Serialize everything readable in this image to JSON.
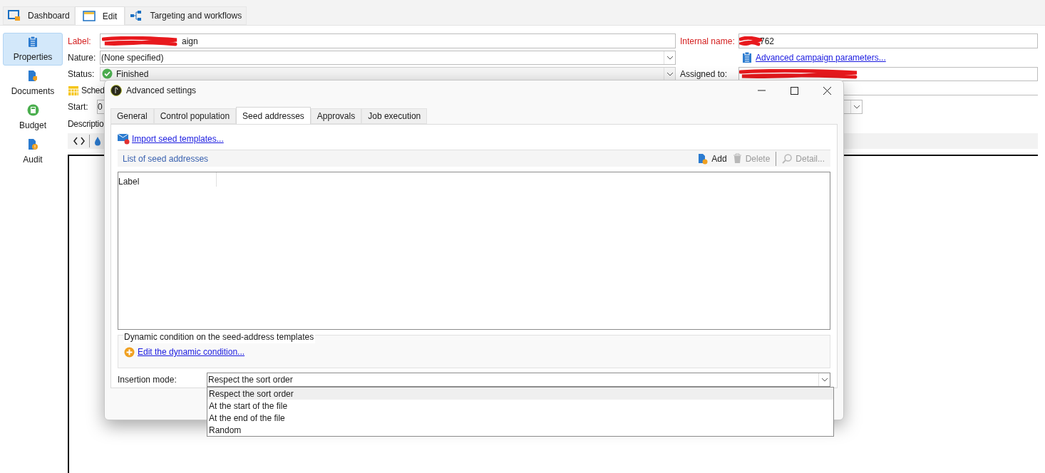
{
  "app_tabs": [
    {
      "label": "Dashboard",
      "selected": false
    },
    {
      "label": "Edit",
      "selected": true
    },
    {
      "label": "Targeting and workflows",
      "selected": false
    }
  ],
  "sidebar": {
    "items": [
      {
        "label": "Properties",
        "selected": true
      },
      {
        "label": "Documents",
        "selected": false
      },
      {
        "label": "Budget",
        "selected": false
      },
      {
        "label": "Audit",
        "selected": false
      }
    ]
  },
  "form": {
    "label": {
      "label": "Label:",
      "value": "aign"
    },
    "internal_name": {
      "label": "Internal name:",
      "value": "762"
    },
    "nature": {
      "label": "Nature:",
      "value": "(None specified)"
    },
    "advanced_link": "Advanced campaign parameters...",
    "status": {
      "label": "Status:",
      "value": "Finished"
    },
    "assigned_to": {
      "label": "Assigned to:"
    },
    "schedule": "Sched",
    "start": {
      "label": "Start:",
      "value": "0"
    },
    "description": "Descriptio"
  },
  "dialog": {
    "title": "Advanced settings",
    "tabs": [
      {
        "label": "General",
        "selected": false
      },
      {
        "label": "Control population",
        "selected": false
      },
      {
        "label": "Seed addresses",
        "selected": true
      },
      {
        "label": "Approvals",
        "selected": false
      },
      {
        "label": "Job execution",
        "selected": false
      }
    ],
    "import_link": "Import seed templates...",
    "list": {
      "title": "List of seed addresses",
      "actions": [
        {
          "kind": "add",
          "label": "Add",
          "disabled": false
        },
        {
          "kind": "delete",
          "label": "Delete",
          "disabled": true
        },
        {
          "kind": "detail",
          "label": "Detail...",
          "disabled": true
        }
      ],
      "columns": [
        "Label"
      ]
    },
    "dynamic_condition": {
      "title": "Dynamic condition on the seed-address templates",
      "link": "Edit the dynamic condition..."
    },
    "insertion_mode": {
      "label": "Insertion mode:",
      "value": "Respect the sort order",
      "expanded": true,
      "options": [
        {
          "label": "Respect the sort order",
          "selected": true
        },
        {
          "label": "At the start of the file",
          "selected": false
        },
        {
          "label": "At the end of the file",
          "selected": false
        },
        {
          "label": "Random",
          "selected": false
        }
      ]
    }
  }
}
